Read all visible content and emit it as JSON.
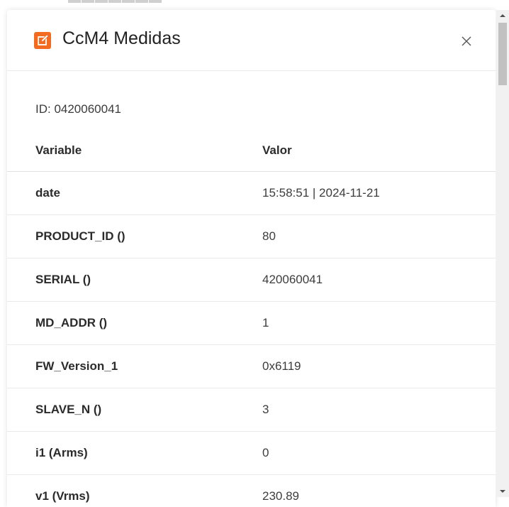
{
  "modal": {
    "title": "CcM4 Medidas",
    "title_icon": "edit-icon",
    "close_icon": "close-icon",
    "device_id_label": "ID: 0420060041"
  },
  "table": {
    "headers": {
      "variable": "Variable",
      "value": "Valor"
    },
    "rows": [
      {
        "variable": "date",
        "value": "15:58:51 | 2024-11-21"
      },
      {
        "variable": "PRODUCT_ID ()",
        "value": "80"
      },
      {
        "variable": "SERIAL ()",
        "value": "420060041"
      },
      {
        "variable": "MD_ADDR ()",
        "value": "1"
      },
      {
        "variable": "FW_Version_1",
        "value": "0x6119"
      },
      {
        "variable": "SLAVE_N ()",
        "value": "3"
      },
      {
        "variable": "i1 (Arms)",
        "value": "0"
      },
      {
        "variable": "v1 (Vrms)",
        "value": "230.89"
      }
    ]
  },
  "colors": {
    "accent": "#f26b21",
    "border": "#e9e9e9"
  },
  "scrollbar": {
    "up_icon": "scroll-up-arrow-icon",
    "down_icon": "scroll-down-arrow-icon"
  }
}
